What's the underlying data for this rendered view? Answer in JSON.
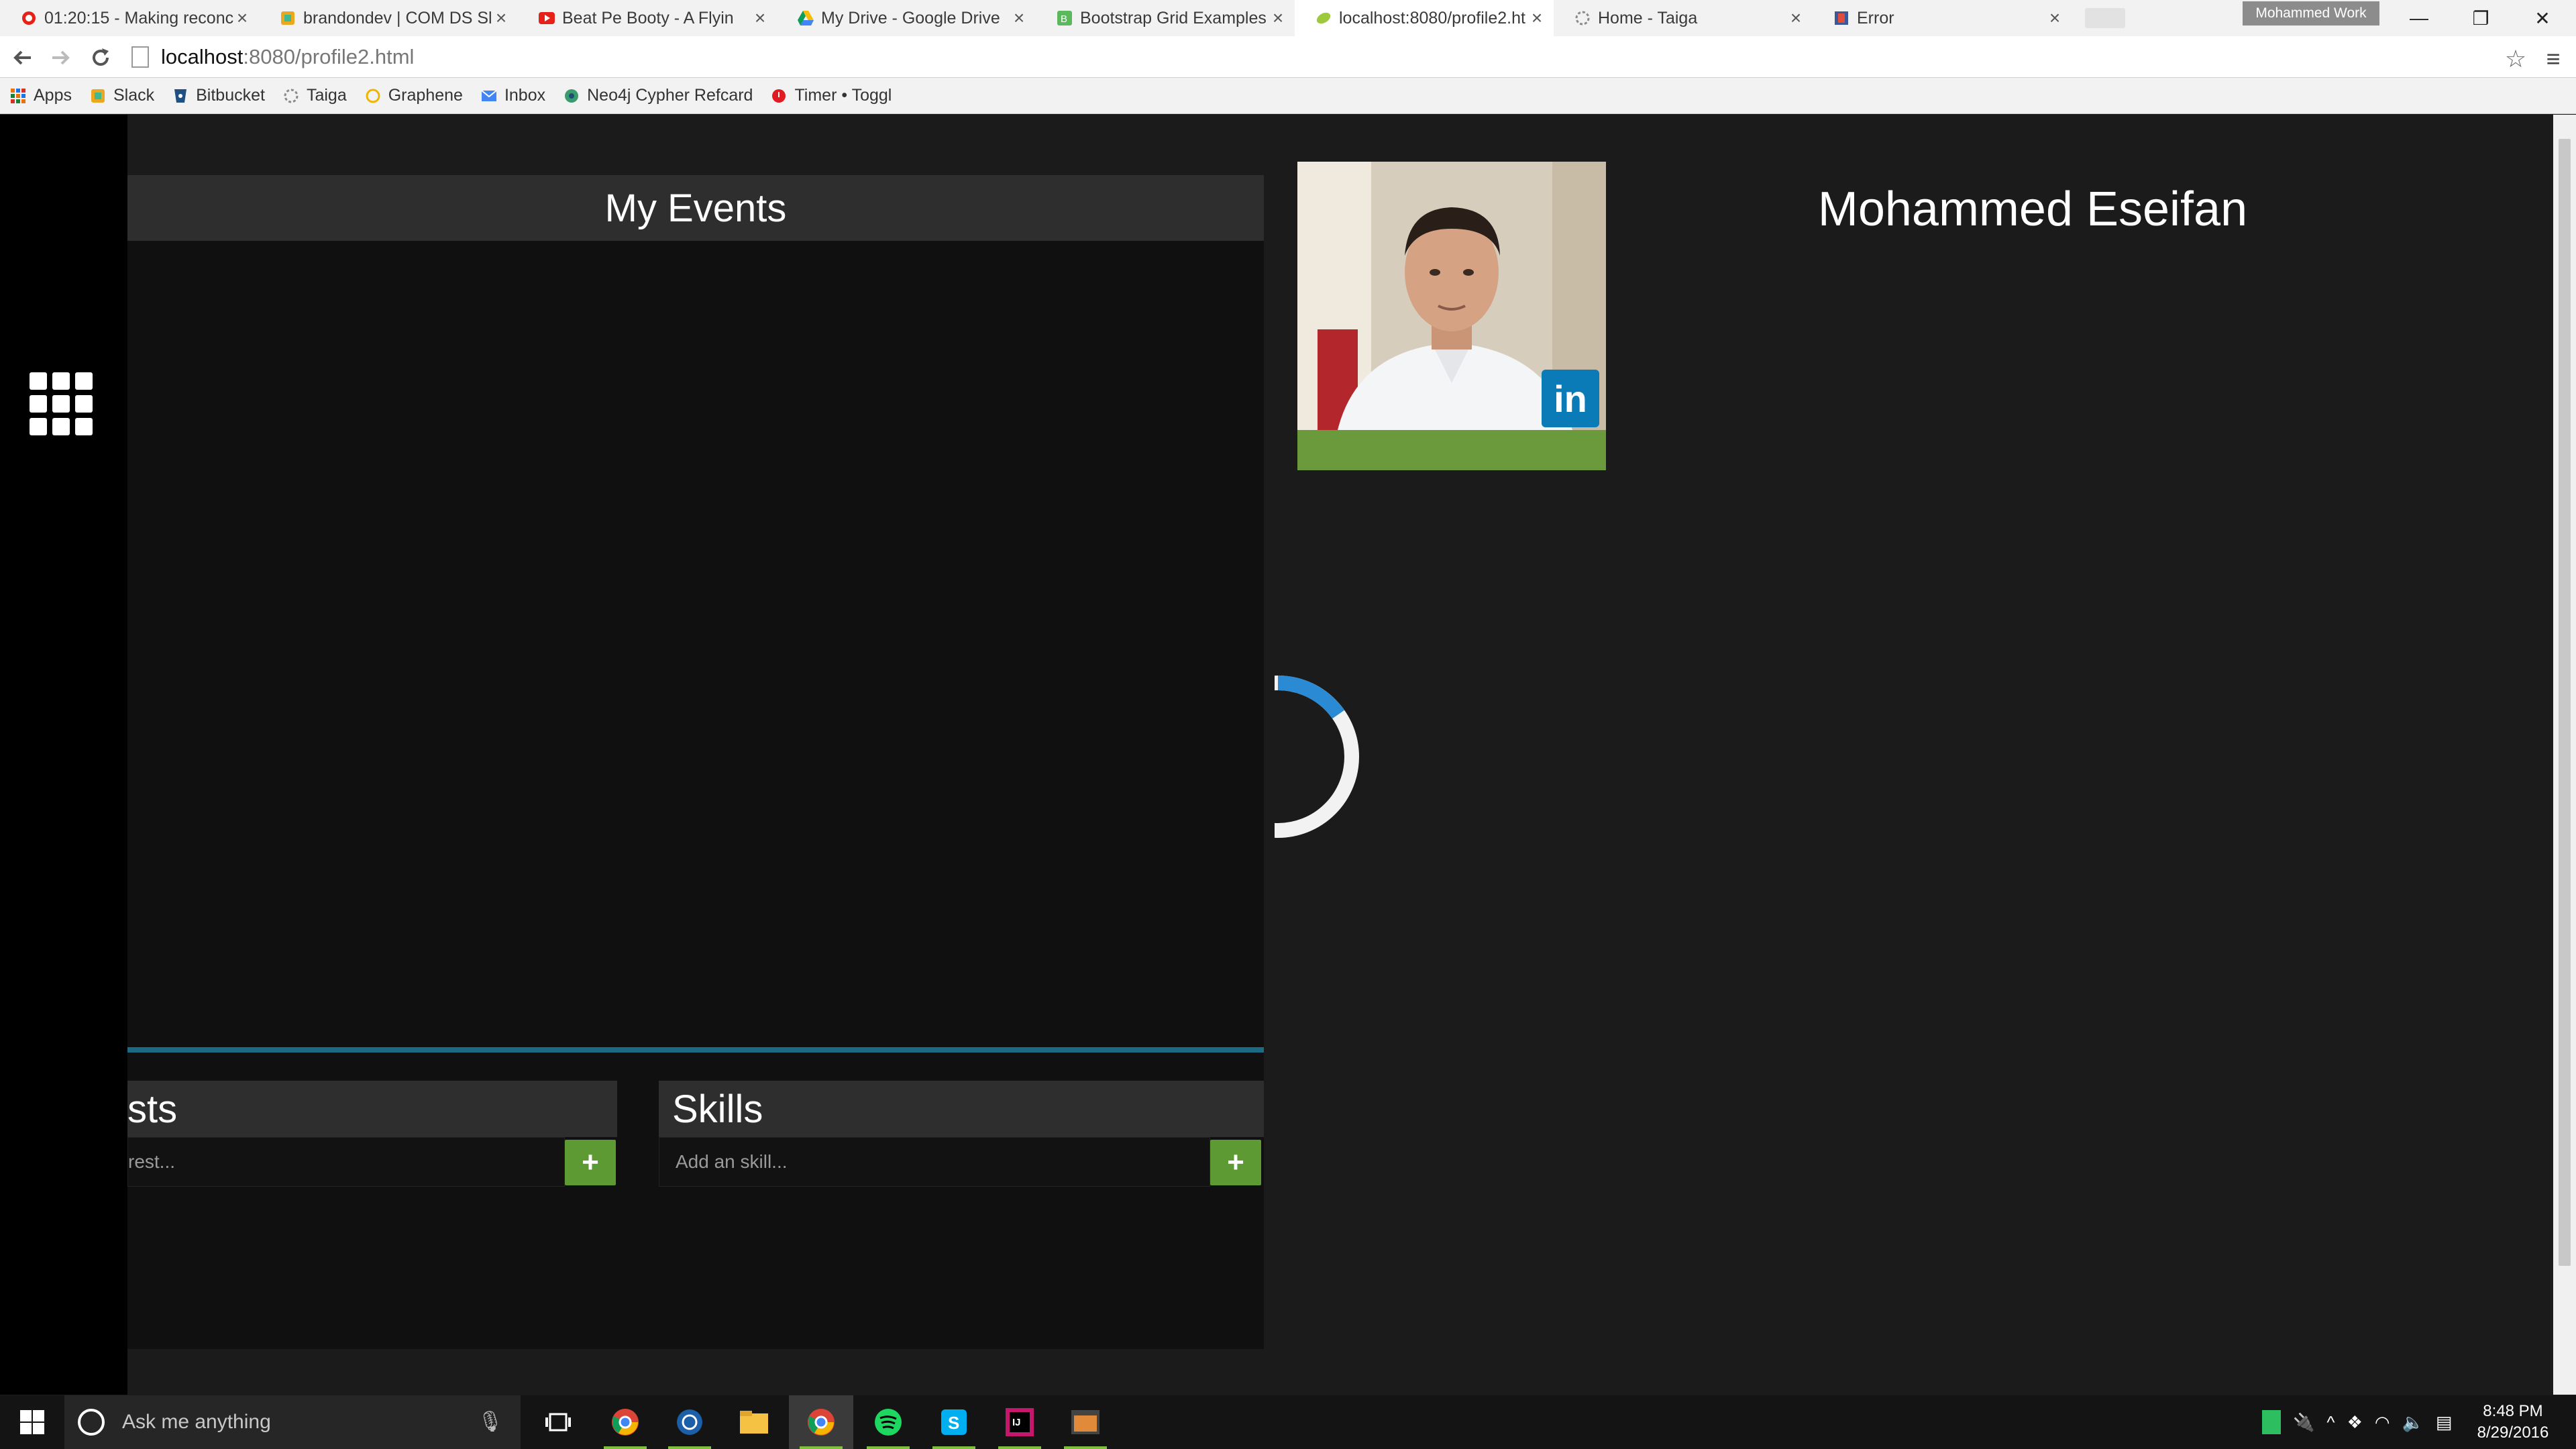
{
  "browser": {
    "tabs": [
      {
        "title": "01:20:15 - Making reconc",
        "favicon": "youtube-record-icon",
        "active": false
      },
      {
        "title": "brandondev | COM DS Sla",
        "favicon": "slack-icon",
        "active": false
      },
      {
        "title": "Beat Pe Booty - A Flyin",
        "favicon": "youtube-icon",
        "active": false
      },
      {
        "title": "My Drive - Google Drive",
        "favicon": "google-drive-icon",
        "active": false
      },
      {
        "title": "Bootstrap Grid Examples",
        "favicon": "bootstrap-icon",
        "active": false
      },
      {
        "title": "localhost:8080/profile2.ht",
        "favicon": "leaf-icon",
        "active": true
      },
      {
        "title": "Home - Taiga",
        "favicon": "taiga-icon",
        "active": false
      },
      {
        "title": "Error",
        "favicon": "error-icon",
        "active": false
      }
    ],
    "profile_name": "Mohammed Work",
    "url": {
      "host": "localhost",
      "path": ":8080/profile2.html"
    },
    "bookmarks": [
      {
        "label": "Apps",
        "icon": "apps-grid-icon"
      },
      {
        "label": "Slack",
        "icon": "slack-icon"
      },
      {
        "label": "Bitbucket",
        "icon": "bitbucket-icon"
      },
      {
        "label": "Taiga",
        "icon": "taiga-icon"
      },
      {
        "label": "Graphene",
        "icon": "graphene-icon"
      },
      {
        "label": "Inbox",
        "icon": "inbox-icon"
      },
      {
        "label": "Neo4j Cypher Refcard",
        "icon": "neo4j-icon"
      },
      {
        "label": "Timer • Toggl",
        "icon": "toggl-icon"
      }
    ]
  },
  "page": {
    "events_title": "My Events",
    "interests": {
      "title": "sts",
      "placeholder": "rest..."
    },
    "skills": {
      "title": "Skills",
      "placeholder": "Add an skill..."
    },
    "add_symbol": "+",
    "profile_name": "Mohammed Eseifan",
    "linkedin_label": "in",
    "colors": {
      "accent_green": "#5d9a34",
      "divider_blue": "#1d6a85",
      "spinner_blue": "#2a8ad4"
    }
  },
  "taskbar": {
    "search_placeholder": "Ask me anything",
    "time": "8:48 PM",
    "date": "8/29/2016"
  }
}
